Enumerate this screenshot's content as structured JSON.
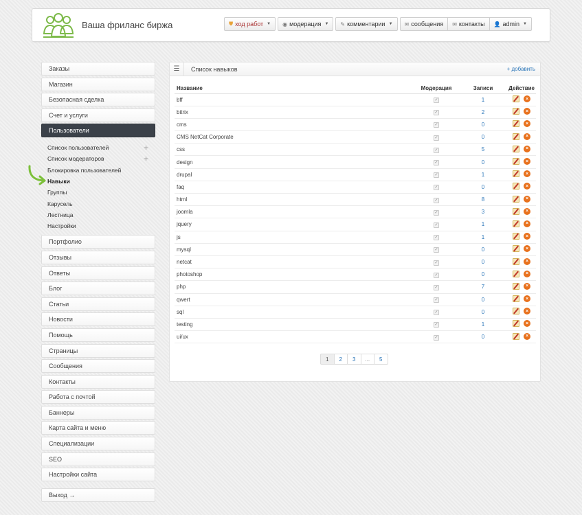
{
  "header": {
    "brand": "Ваша фриланс биржа",
    "nav": [
      {
        "label": "ход работ",
        "icon": "shield-icon"
      },
      {
        "label": "модерация",
        "icon": "eye-icon"
      },
      {
        "label": "комментарии",
        "icon": "pencil-icon"
      },
      {
        "label": "сообщения",
        "icon": "envelope-icon"
      },
      {
        "label": "контакты",
        "icon": "envelope-icon"
      },
      {
        "label": "admin",
        "icon": "user-icon"
      }
    ]
  },
  "sidebar": {
    "top": [
      "Заказы",
      "Магазин",
      "Безопасная сделка",
      "Счет и услуги"
    ],
    "active": "Пользователи",
    "sub": [
      "Список пользователей",
      "Список модераторов",
      "Блокировка пользователей",
      "Навыки",
      "Группы",
      "Карусель",
      "Лестница",
      "Настройки"
    ],
    "bottom": [
      "Портфолио",
      "Отзывы",
      "Ответы",
      "Блог",
      "Статьи",
      "Новости",
      "Помощь",
      "Страницы",
      "Сообщения",
      "Контакты",
      "Работа с почтой",
      "Баннеры",
      "Карта сайта и меню",
      "Специализации",
      "SEO",
      "Настройки сайта"
    ],
    "logout": "Выход →"
  },
  "panel": {
    "title": "Список навыков",
    "add": "+ добавить",
    "columns": [
      "Название",
      "Модерация",
      "Записи",
      "Действие"
    ],
    "rows": [
      {
        "name": "bff",
        "count": "1"
      },
      {
        "name": "bitrix",
        "count": "2"
      },
      {
        "name": "cms",
        "count": "0"
      },
      {
        "name": "CMS NetCat Corporate",
        "count": "0"
      },
      {
        "name": "css",
        "count": "5"
      },
      {
        "name": "design",
        "count": "0"
      },
      {
        "name": "drupal",
        "count": "1"
      },
      {
        "name": "faq",
        "count": "0"
      },
      {
        "name": "html",
        "count": "8"
      },
      {
        "name": "joomla",
        "count": "3"
      },
      {
        "name": "jquery",
        "count": "1"
      },
      {
        "name": "js",
        "count": "1"
      },
      {
        "name": "mysql",
        "count": "0"
      },
      {
        "name": "netcat",
        "count": "0"
      },
      {
        "name": "photoshop",
        "count": "0"
      },
      {
        "name": "php",
        "count": "7"
      },
      {
        "name": "qwert",
        "count": "0"
      },
      {
        "name": "sql",
        "count": "0"
      },
      {
        "name": "testing",
        "count": "1"
      },
      {
        "name": "ui/ux",
        "count": "0"
      }
    ],
    "pager": [
      "1",
      "2",
      "3",
      "...",
      "5"
    ],
    "current_page": "1"
  }
}
